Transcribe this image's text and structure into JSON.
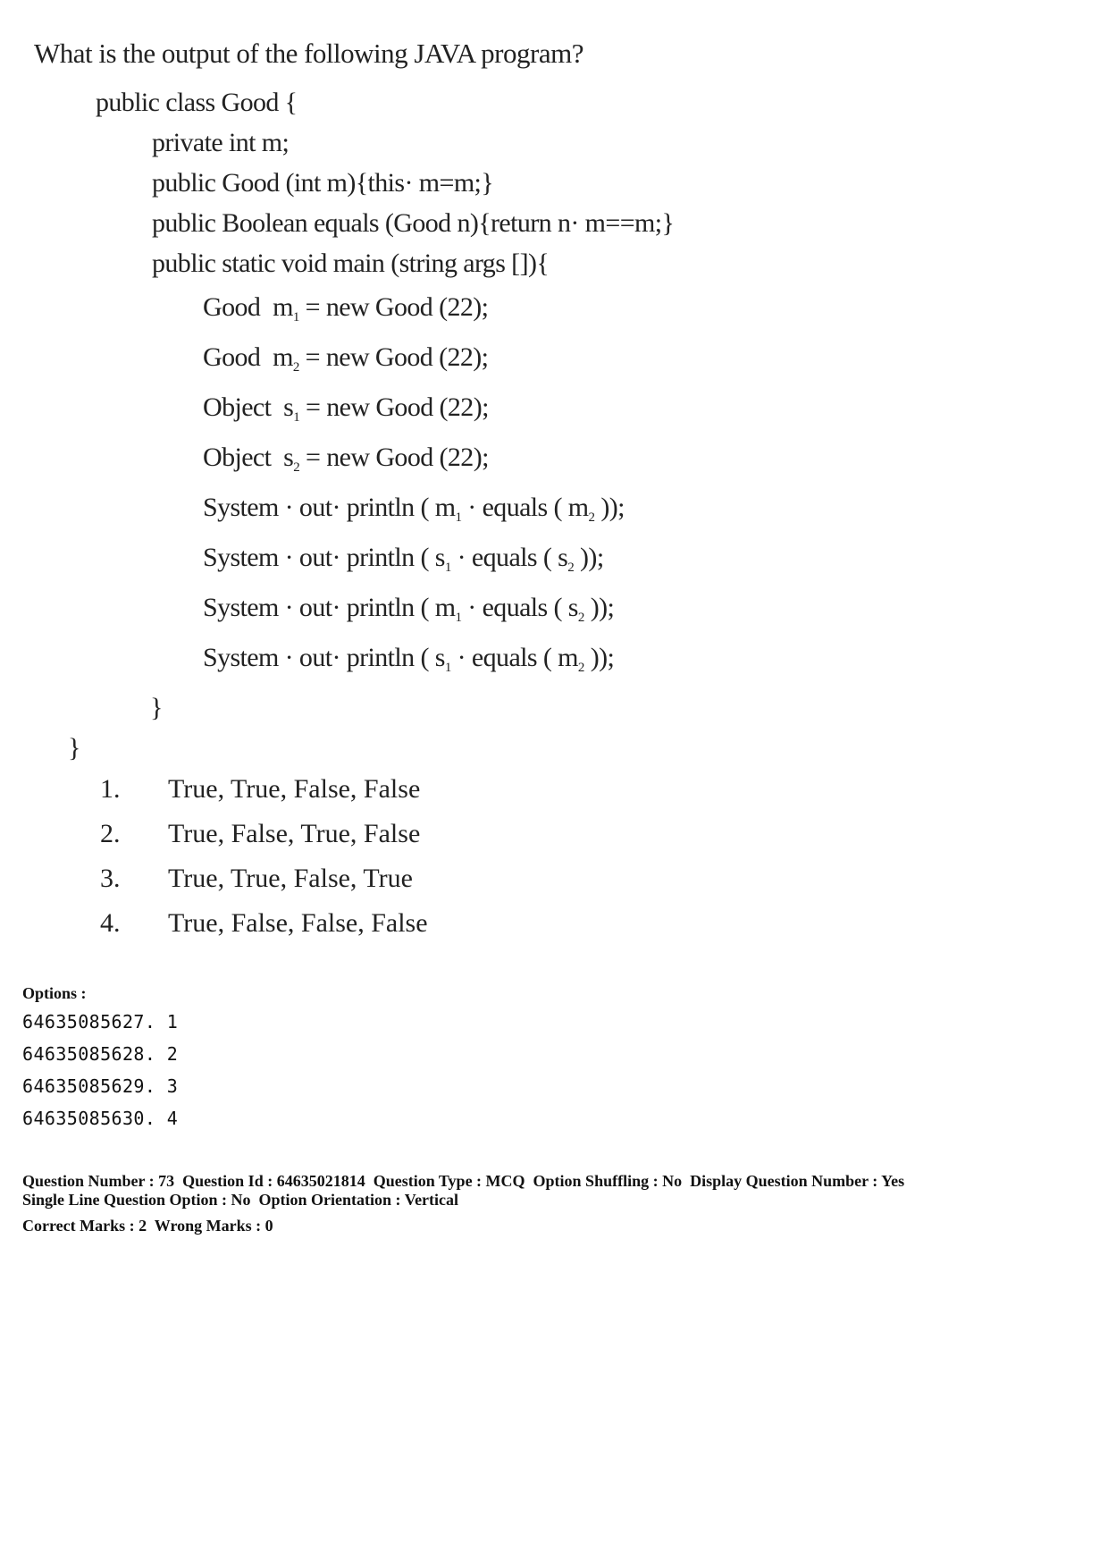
{
  "question": {
    "title": "What is the output of the following JAVA program?",
    "code": {
      "class_decl": "public class Good {",
      "field": "private int m;",
      "constructor": "public Good (int m){this· m=m;}",
      "equals_method": "public Boolean equals (Good n){return n· m==m;}",
      "main_decl": "public static void main (string args []){",
      "stmt1": {
        "pre": "Good  m",
        "sub": "1",
        "post": " = new Good (22);"
      },
      "stmt2": {
        "pre": "Good  m",
        "sub": "2",
        "post": " = new Good (22);"
      },
      "stmt3": {
        "pre": "Object  s",
        "sub": "1",
        "post": " = new Good (22);"
      },
      "stmt4": {
        "pre": "Object  s",
        "sub": "2",
        "post": " = new Good (22);"
      },
      "print1": {
        "a": "System · out· println ( m",
        "a_sub": "1",
        "b": " · equals ( m",
        "b_sub": "2",
        "c": " ));"
      },
      "print2": {
        "a": "System · out· println ( s",
        "a_sub": "1",
        "b": " · equals ( s",
        "b_sub": "2",
        "c": " ));"
      },
      "print3": {
        "a": "System · out· println ( m",
        "a_sub": "1",
        "b": " · equals ( s",
        "b_sub": "2",
        "c": " ));"
      },
      "print4": {
        "a": "System · out· println ( s",
        "a_sub": "1",
        "b": " · equals ( m",
        "b_sub": "2",
        "c": " ));"
      },
      "close_main": "}",
      "close_class": "}"
    },
    "choices": [
      {
        "num": "1.",
        "text": "True, True, False, False"
      },
      {
        "num": "2.",
        "text": "True, False, True, False"
      },
      {
        "num": "3.",
        "text": "True, True, False, True"
      },
      {
        "num": "4.",
        "text": "True, False, False, False"
      }
    ]
  },
  "options": {
    "label": "Options :",
    "items": [
      "64635085627. 1",
      "64635085628. 2",
      "64635085629. 3",
      "64635085630. 4"
    ]
  },
  "meta": {
    "line1": "Question Number : 73  Question Id : 64635021814  Question Type : MCQ  Option Shuffling : No  Display Question Number : Yes",
    "line2": "Single Line Question Option : No  Option Orientation : Vertical",
    "line3": "Correct Marks : 2  Wrong Marks : 0"
  }
}
